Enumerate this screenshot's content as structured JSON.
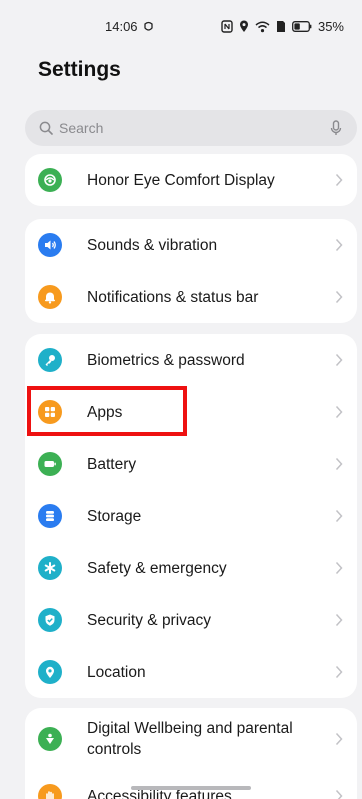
{
  "status_bar": {
    "time": "14:06",
    "battery": "35%"
  },
  "page": {
    "title": "Settings"
  },
  "search": {
    "placeholder": "Search"
  },
  "groups": [
    {
      "items": [
        {
          "label": "Honor Eye Comfort Display",
          "icon": "eye-comfort-icon",
          "color": "#3cb054"
        }
      ]
    },
    {
      "items": [
        {
          "label": "Sounds & vibration",
          "icon": "sound-icon",
          "color": "#2a7cf0"
        },
        {
          "label": "Notifications & status bar",
          "icon": "bell-icon",
          "color": "#f79a1e"
        }
      ]
    },
    {
      "items": [
        {
          "label": "Biometrics & password",
          "icon": "key-icon",
          "color": "#1fb0c9"
        },
        {
          "label": "Apps",
          "icon": "apps-icon",
          "color": "#f79a1e"
        },
        {
          "label": "Battery",
          "icon": "battery-icon",
          "color": "#3cb054"
        },
        {
          "label": "Storage",
          "icon": "storage-icon",
          "color": "#2a7cf0"
        },
        {
          "label": "Safety & emergency",
          "icon": "asterisk-icon",
          "color": "#1fb0c9"
        },
        {
          "label": "Security & privacy",
          "icon": "shield-icon",
          "color": "#1fb0c9"
        },
        {
          "label": "Location",
          "icon": "location-pin-icon",
          "color": "#1fb0c9"
        }
      ]
    },
    {
      "items": [
        {
          "label": "Digital Wellbeing and parental controls",
          "icon": "wellbeing-icon",
          "color": "#3cb054"
        },
        {
          "label": "Accessibility features",
          "icon": "hand-icon",
          "color": "#f79a1e"
        }
      ]
    }
  ],
  "colors": {
    "highlight": "#ee1111",
    "background": "#f2f2f4"
  }
}
